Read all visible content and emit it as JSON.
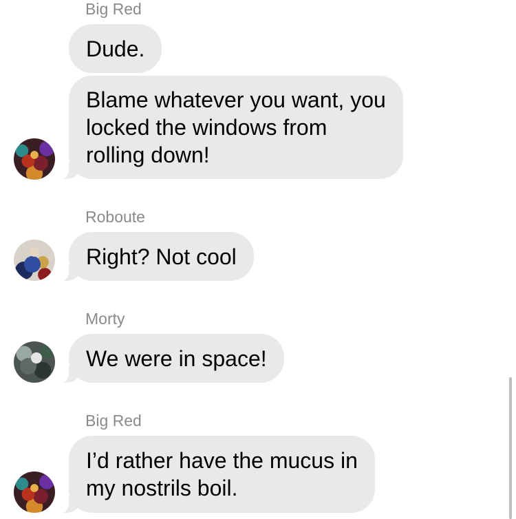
{
  "messages": [
    {
      "sender": "Big Red",
      "bubbles": [
        "Dude.",
        "Blame whatever you want, you\nlocked the windows from\nrolling down!"
      ],
      "avatar_icon": "big-red-avatar-icon"
    },
    {
      "sender": "Roboute",
      "bubbles": [
        "Right? Not cool"
      ],
      "avatar_icon": "roboute-avatar-icon"
    },
    {
      "sender": "Morty",
      "bubbles": [
        "We were in space!"
      ],
      "avatar_icon": "morty-avatar-icon"
    },
    {
      "sender": "Big Red",
      "bubbles": [
        "I’d rather have the mucus in\nmy nostrils boil."
      ],
      "avatar_icon": "big-red-avatar-icon"
    }
  ],
  "colors": {
    "bubble_background": "#e9e9eb",
    "sender_text": "#8a8a8e",
    "message_text": "#000000"
  }
}
